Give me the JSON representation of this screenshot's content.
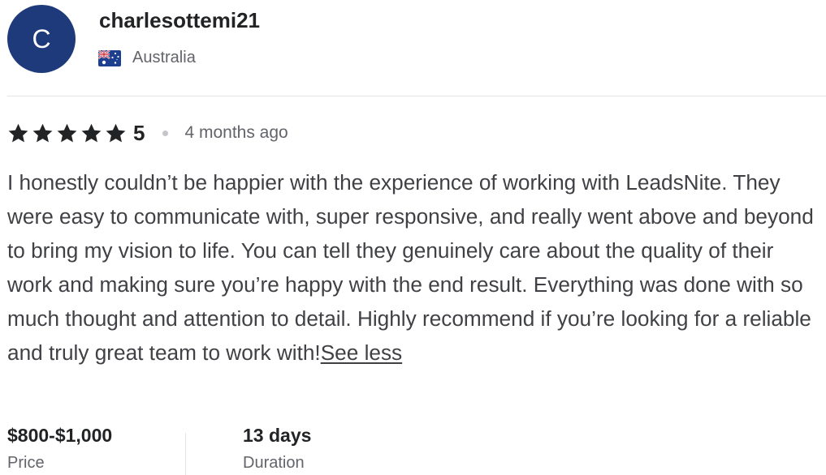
{
  "reviewer": {
    "avatar_initial": "C",
    "avatar_color": "#1f3a7a",
    "username": "charlesottemi21",
    "country": "Australia",
    "flag_icon": "australia-flag-icon"
  },
  "review": {
    "rating": 5,
    "rating_label": "5",
    "time_ago": "4 months ago",
    "text": "I honestly couldn’t be happier with the experience of working with LeadsNite. They were easy to communicate with, super responsive, and really went above and beyond to bring my vision to life. You can tell they genuinely care about the quality of their work and making sure you’re happy with the end result. Everything was done with so much thought and attention to detail. Highly recommend if you’re looking for a reliable and truly great team to work with!",
    "see_less_label": "See less",
    "star_color": "#222325"
  },
  "details": {
    "price_value": "$800-$1,000",
    "price_label": "Price",
    "duration_value": "13 days",
    "duration_label": "Duration"
  }
}
